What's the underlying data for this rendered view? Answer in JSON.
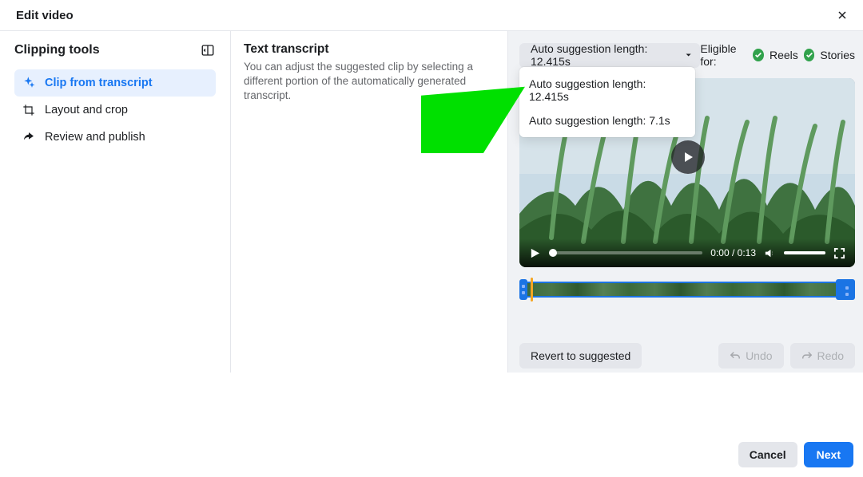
{
  "header": {
    "title": "Edit video"
  },
  "sidebar": {
    "title": "Clipping tools",
    "items": [
      {
        "label": "Clip from transcript"
      },
      {
        "label": "Layout and crop"
      },
      {
        "label": "Review and publish"
      }
    ]
  },
  "transcript": {
    "title": "Text transcript",
    "description": "You can adjust the suggested clip by selecting a different portion of the automatically generated transcript."
  },
  "right": {
    "length_button": "Auto suggestion length: 12.415s",
    "eligible_label": "Eligible for:",
    "eligible_reels": "Reels",
    "eligible_stories": "Stories",
    "dropdown": [
      {
        "label": "Auto suggestion length: 12.415s"
      },
      {
        "label": "Auto suggestion length: 7.1s"
      }
    ],
    "player": {
      "current_time": "0:00",
      "separator": " / ",
      "total_time": "0:13"
    },
    "revert": "Revert to suggested",
    "undo": "Undo",
    "redo": "Redo"
  },
  "footer": {
    "cancel": "Cancel",
    "next": "Next"
  }
}
